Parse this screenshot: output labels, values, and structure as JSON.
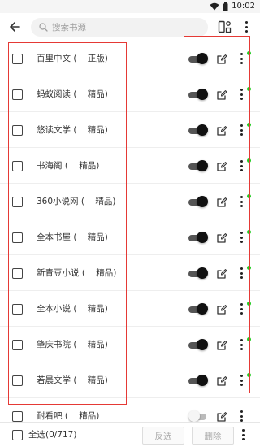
{
  "status_bar": {
    "time": "10:02"
  },
  "toolbar": {
    "search_placeholder": "搜索书源"
  },
  "sources": [
    {
      "name": "百里中文 (    正版)",
      "enabled": true
    },
    {
      "name": "蚂蚁阅读 (    精品)",
      "enabled": true
    },
    {
      "name": "悠读文学 (    精品)",
      "enabled": true
    },
    {
      "name": "书海阁 (    精品)",
      "enabled": true
    },
    {
      "name": "360小说网 (    精品)",
      "enabled": true
    },
    {
      "name": "全本书屋 (    精品)",
      "enabled": true
    },
    {
      "name": "新青豆小说 (    精品)",
      "enabled": true
    },
    {
      "name": "全本小说 (    精品)",
      "enabled": true
    },
    {
      "name": "肇庆书院 (    精品)",
      "enabled": true
    },
    {
      "name": "若晨文学 (    精品)",
      "enabled": true
    },
    {
      "name": "耐看吧 (    精品)",
      "enabled": false
    }
  ],
  "bottom_bar": {
    "select_all_label": "全选(0/717)",
    "invert_label": "反选",
    "delete_label": "删除"
  },
  "colors": {
    "highlight": "#e53935",
    "enabled_dot": "#22cc22",
    "toggle_on": "#111111"
  }
}
